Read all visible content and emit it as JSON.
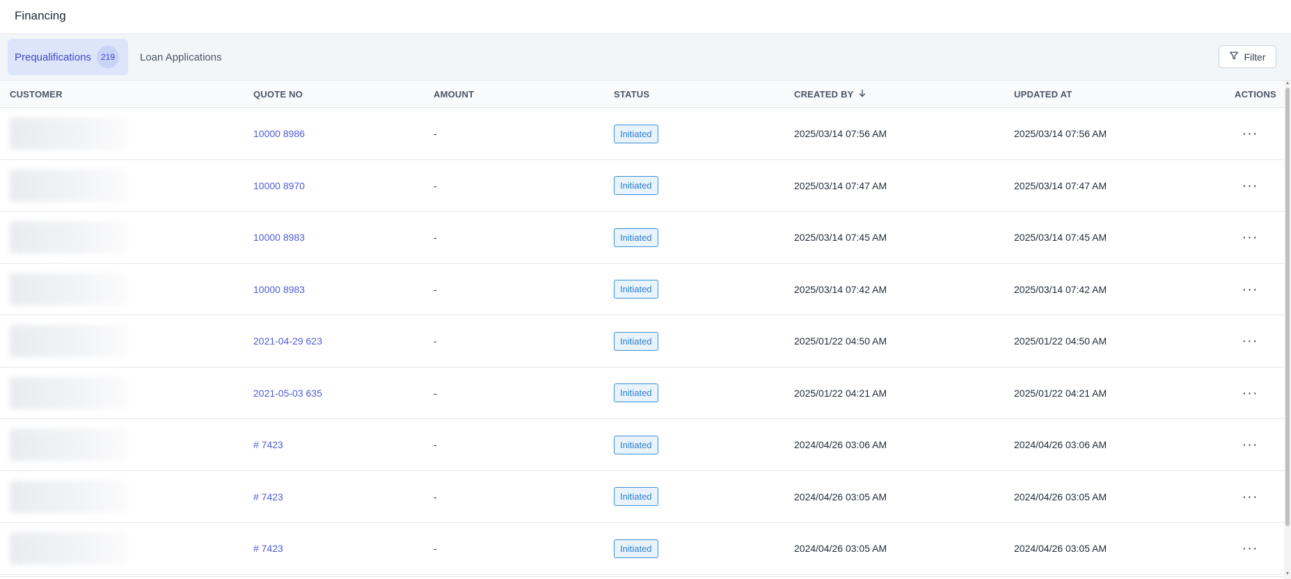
{
  "header": {
    "title": "Financing"
  },
  "tabs": {
    "prequalifications": {
      "label": "Prequalifications",
      "count": "219"
    },
    "loan_applications": {
      "label": "Loan Applications"
    }
  },
  "toolbar": {
    "filter_label": "Filter",
    "filter_icon": "funnel-icon"
  },
  "table": {
    "columns": {
      "customer": "CUSTOMER",
      "quote_no": "QUOTE NO",
      "amount": "AMOUNT",
      "status": "STATUS",
      "created_by": "CREATED BY",
      "updated_at": "UPDATED AT",
      "actions": "ACTIONS"
    },
    "sort": {
      "column": "created_by",
      "direction": "descending",
      "icon": "arrow-down-icon"
    },
    "rows": [
      {
        "quote_no": "10000 8986",
        "amount": "-",
        "status": "Initiated",
        "created_by": "2025/03/14 07:56 AM",
        "updated_at": "2025/03/14 07:56 AM"
      },
      {
        "quote_no": "10000 8970",
        "amount": "-",
        "status": "Initiated",
        "created_by": "2025/03/14 07:47 AM",
        "updated_at": "2025/03/14 07:47 AM"
      },
      {
        "quote_no": "10000 8983",
        "amount": "-",
        "status": "Initiated",
        "created_by": "2025/03/14 07:45 AM",
        "updated_at": "2025/03/14 07:45 AM"
      },
      {
        "quote_no": "10000 8983",
        "amount": "-",
        "status": "Initiated",
        "created_by": "2025/03/14 07:42 AM",
        "updated_at": "2025/03/14 07:42 AM"
      },
      {
        "quote_no": "2021-04-29 623",
        "amount": "-",
        "status": "Initiated",
        "created_by": "2025/01/22 04:50 AM",
        "updated_at": "2025/01/22 04:50 AM"
      },
      {
        "quote_no": "2021-05-03 635",
        "amount": "-",
        "status": "Initiated",
        "created_by": "2025/01/22 04:21 AM",
        "updated_at": "2025/01/22 04:21 AM"
      },
      {
        "quote_no": "# 7423",
        "amount": "-",
        "status": "Initiated",
        "created_by": "2024/04/26 03:06 AM",
        "updated_at": "2024/04/26 03:06 AM"
      },
      {
        "quote_no": "# 7423",
        "amount": "-",
        "status": "Initiated",
        "created_by": "2024/04/26 03:05 AM",
        "updated_at": "2024/04/26 03:05 AM"
      },
      {
        "quote_no": "# 7423",
        "amount": "-",
        "status": "Initiated",
        "created_by": "2024/04/26 03:05 AM",
        "updated_at": "2024/04/26 03:05 AM"
      }
    ]
  },
  "colors": {
    "accent": "#3f46c9",
    "link": "#4f5bd5",
    "status_border": "#3b8fd8",
    "status_bg": "#e8f3fc"
  }
}
